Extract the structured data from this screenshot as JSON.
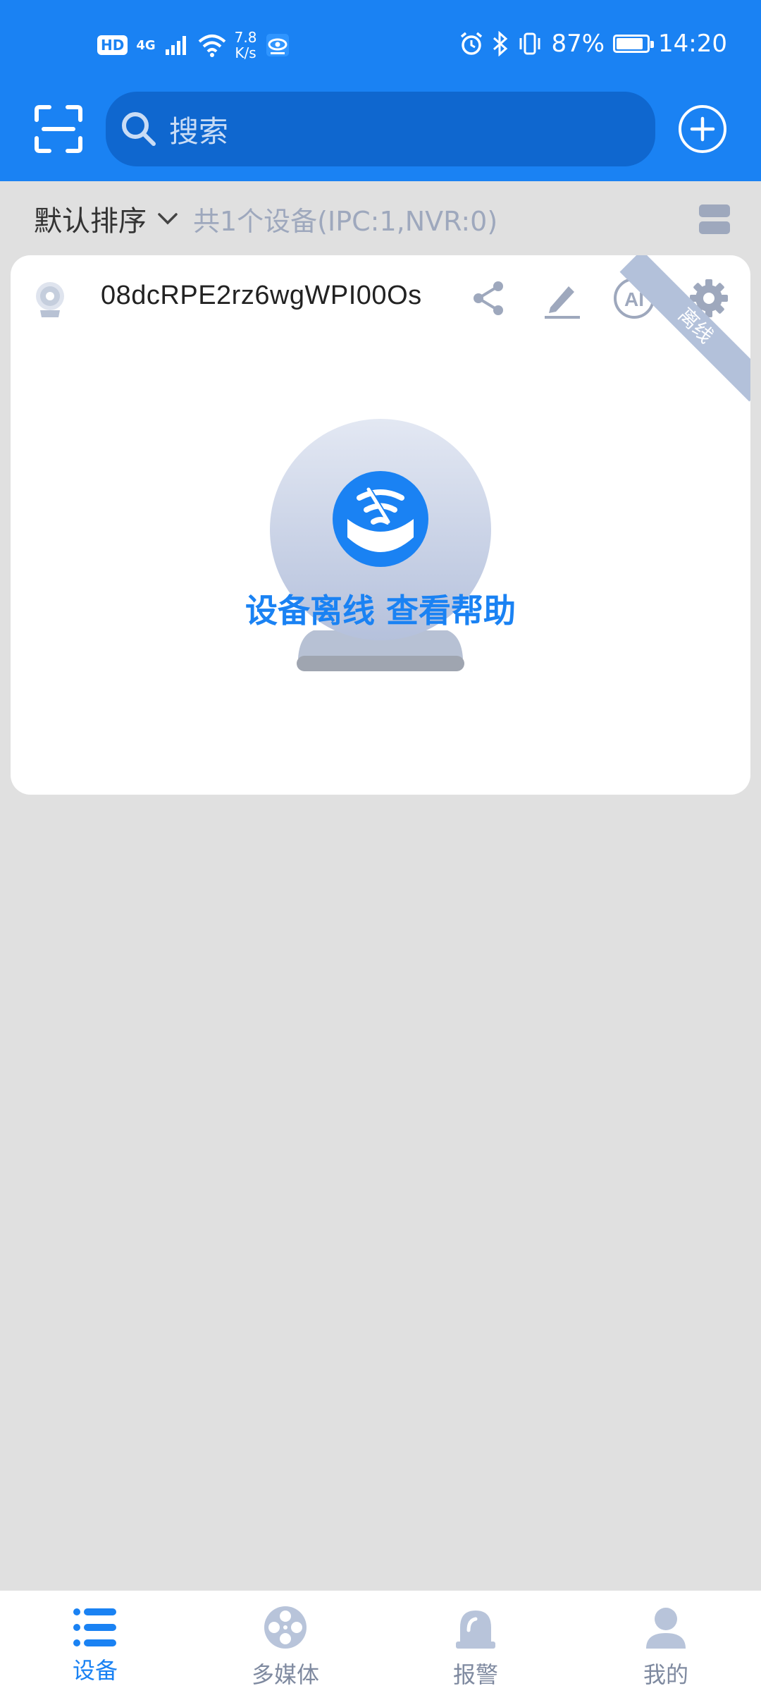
{
  "status_bar": {
    "hd": "HD",
    "network": "4G",
    "speed_value": "7.8",
    "speed_unit": "K/s",
    "battery": "87%",
    "battery_level": 0.87,
    "time": "14:20"
  },
  "header": {
    "search_placeholder": "搜索"
  },
  "sort_bar": {
    "sort_label": "默认排序",
    "device_count": "共1个设备(IPC:1,NVR:0)"
  },
  "device_card": {
    "name": "08dcRPE2rz6wgWPI00Os",
    "status_ribbon": "离线",
    "offline_help": "设备离线 查看帮助"
  },
  "tabs": [
    {
      "label": "设备",
      "icon": "list-icon",
      "active": true
    },
    {
      "label": "多媒体",
      "icon": "film-reel-icon",
      "active": false
    },
    {
      "label": "报警",
      "icon": "alarm-light-icon",
      "active": false
    },
    {
      "label": "我的",
      "icon": "user-icon",
      "active": false
    }
  ],
  "colors": {
    "primary": "#1a82f3",
    "search_bg": "#0f67cf",
    "page_bg": "#e0e0e0",
    "muted_icon": "#9ea8bd",
    "ribbon": "#b3c1da"
  }
}
